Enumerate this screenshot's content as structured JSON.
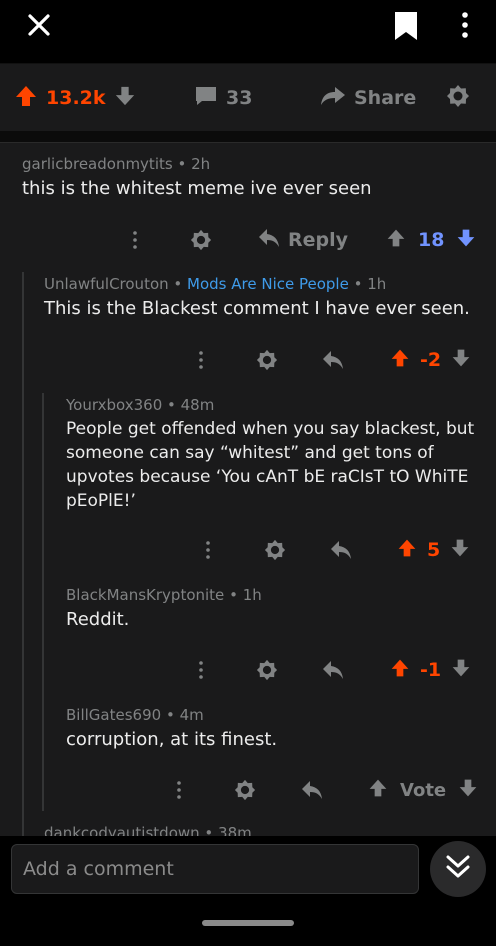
{
  "post_actions": {
    "score": "13.2k",
    "comment_count": "33",
    "share_label": "Share"
  },
  "comments": [
    {
      "author": "garlicbreadonmytits",
      "flair": "",
      "age": "2h",
      "body": "this is the whitest meme ive ever seen",
      "reply_label": "Reply",
      "score": "18",
      "vote_state": "downvoted"
    },
    {
      "author": "UnlawfulCrouton",
      "flair": "Mods Are Nice People",
      "age": "1h",
      "body": "This is the Blackest comment I have ever seen.",
      "score": "-2",
      "vote_state": "upvoted"
    },
    {
      "author": "Yourxbox360",
      "age": "48m",
      "body": "People get offended when you say blackest, but someone can say “whitest” and get tons of upvotes because ‘You cAnT bE raCIsT tO WhiTE pEoPlE!’",
      "score": "5",
      "vote_state": "upvoted"
    },
    {
      "author": "BlackMansKryptonite",
      "age": "1h",
      "body": "Reddit.",
      "score": "-1",
      "vote_state": "upvoted"
    },
    {
      "author": "BillGates690",
      "age": "4m",
      "body": "corruption, at its finest.",
      "score": "Vote",
      "vote_state": "none"
    },
    {
      "author": "dankcodyautistdown",
      "age": "38m"
    }
  ],
  "comment_box": {
    "placeholder": "Add a comment"
  },
  "colors": {
    "upvote": "#ff4500",
    "downvote": "#7193ff",
    "flair": "#3f9be9",
    "muted": "#818384",
    "surface": "#1a1a1b"
  },
  "icons": [
    "close-icon",
    "bookmark-icon",
    "more-vertical-icon",
    "upvote-icon",
    "downvote-icon",
    "comment-icon",
    "share-arrow-icon",
    "award-icon",
    "reply-icon",
    "double-chevron-down-icon"
  ]
}
